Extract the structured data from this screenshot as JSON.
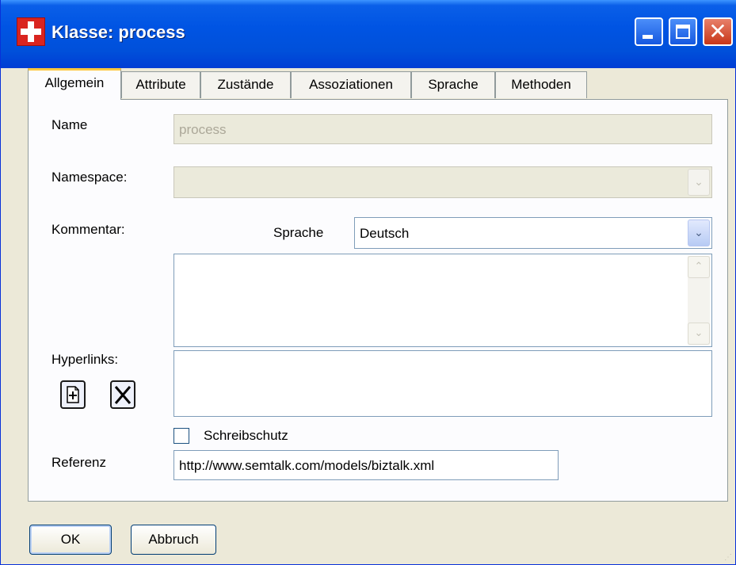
{
  "window": {
    "title": "Klasse: process",
    "close_symbol": "✕"
  },
  "tabs": [
    {
      "label": "Allgemein"
    },
    {
      "label": "Attribute"
    },
    {
      "label": "Zustände"
    },
    {
      "label": "Assoziationen"
    },
    {
      "label": "Sprache"
    },
    {
      "label": "Methoden"
    }
  ],
  "form": {
    "name_label": "Name",
    "name_value": "process",
    "namespace_label": "Namespace:",
    "namespace_value": "",
    "kommentar_label": "Kommentar:",
    "sprache_label": "Sprache",
    "sprache_value": "Deutsch",
    "comment_text": "",
    "hyperlinks_label": "Hyperlinks:",
    "schreibschutz_label": "Schreibschutz",
    "schreibschutz_checked": false,
    "referenz_label": "Referenz",
    "referenz_value": "http://www.semtalk.com/models/biztalk.xml"
  },
  "buttons": {
    "ok": "OK",
    "cancel": "Abbruch"
  },
  "icons": {
    "dropdown_arrow": "⌄",
    "scroll_up": "⌃",
    "scroll_down": "⌄",
    "add_hyperlink": "add-document-icon",
    "delete_hyperlink": "delete-x-icon"
  },
  "colors": {
    "titlebar": "#0054e3",
    "dialog_bg": "#ece9d8",
    "active_tab_accent": "#ffc83c"
  }
}
